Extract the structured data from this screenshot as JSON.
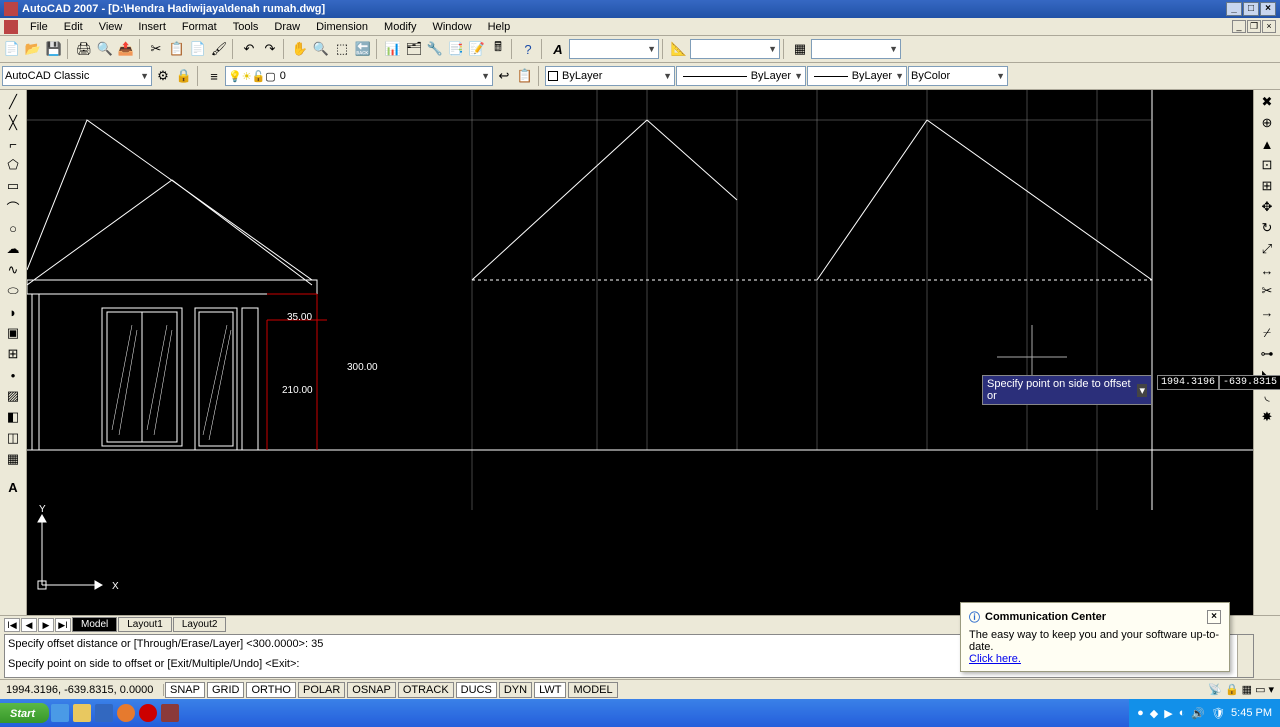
{
  "title": "AutoCAD 2007 - [D:\\Hendra Hadiwijaya\\denah rumah.dwg]",
  "menu": [
    "File",
    "Edit",
    "View",
    "Insert",
    "Format",
    "Tools",
    "Draw",
    "Dimension",
    "Modify",
    "Window",
    "Help"
  ],
  "workspace": "AutoCAD Classic",
  "layer_value": "0",
  "prop_bylayer": "ByLayer",
  "prop_linetype": "ByLayer",
  "prop_lineweight": "ByLayer",
  "prop_color": "ByColor",
  "tabs": {
    "model": "Model",
    "layout1": "Layout1",
    "layout2": "Layout2"
  },
  "cmd_line1": "Specify offset distance or [Through/Erase/Layer] <300.0000>: 35",
  "cmd_line2": "Specify point on side to offset or [Exit/Multiple/Undo] <Exit>:",
  "coords": "1994.3196, -639.8315, 0.0000",
  "toggles": [
    "SNAP",
    "GRID",
    "ORTHO",
    "POLAR",
    "OSNAP",
    "OTRACK",
    "DUCS",
    "DYN",
    "LWT",
    "MODEL"
  ],
  "start": "Start",
  "time": "5:45 PM",
  "dyn_prompt": "Specify point on side to offset or",
  "dyn_x": "1994.3196",
  "dyn_y": "-639.8315",
  "dims": {
    "d1": "35.00",
    "d2": "300.00",
    "d3": "210.00"
  },
  "axes": {
    "x": "X",
    "y": "Y"
  },
  "popup": {
    "title": "Communication Center",
    "body": "The easy way to keep you and your software up-to-date.",
    "link": "Click here."
  }
}
